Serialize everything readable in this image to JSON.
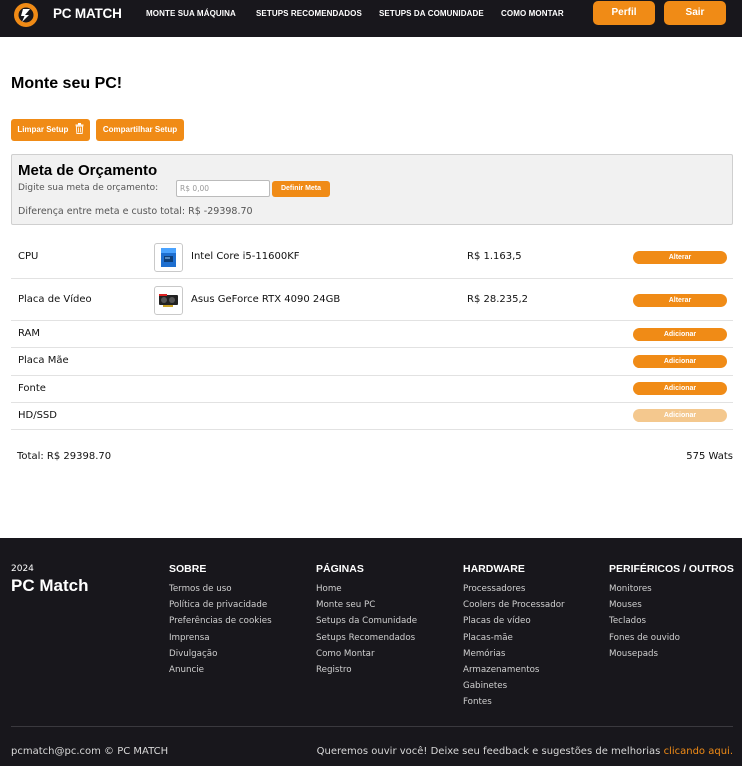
{
  "colors": {
    "accent": "#f08b16",
    "dark": "#18171c"
  },
  "nav": {
    "brand": "PC MATCH",
    "links": [
      "MONTE SUA MÁQUINA",
      "SETUPS RECOMENDADOS",
      "SETUPS DA COMUNIDADE",
      "COMO MONTAR"
    ],
    "profile_button": "Perfil",
    "logout_button": "Sair"
  },
  "main": {
    "title": "Monte seu PC!",
    "clear_button": "Limpar Setup",
    "share_button": "Compartilhar Setup",
    "budget": {
      "title": "Meta de Orçamento",
      "label": "Digite sua meta de orçamento:",
      "placeholder": "R$ 0,00",
      "button": "Definir Meta",
      "difference_text": "Diferença entre meta e custo total: R$ -29398.70"
    },
    "components": [
      {
        "label": "CPU",
        "product": "Intel Core i5-11600KF",
        "price": "R$ 1.163,5",
        "action": "Alterar",
        "icon": "cpu-box-icon"
      },
      {
        "label": "Placa de Vídeo",
        "product": "Asus GeForce RTX 4090 24GB",
        "price": "R$ 28.235,2",
        "action": "Alterar",
        "icon": "gpu-icon"
      },
      {
        "label": "RAM",
        "action": "Adicionar"
      },
      {
        "label": "Placa Mãe",
        "action": "Adicionar"
      },
      {
        "label": "Fonte",
        "action": "Adicionar"
      },
      {
        "label": "HD/SSD",
        "action": "Adicionar"
      }
    ],
    "total": "Total: R$ 29398.70",
    "watts": "575 Wats"
  },
  "footer": {
    "year": "2024",
    "brand": "PC Match",
    "columns": [
      {
        "title": "SOBRE",
        "links": [
          "Termos de uso",
          "Política de privacidade",
          "Preferências de cookies",
          "Imprensa",
          "Divulgação",
          "Anuncie"
        ]
      },
      {
        "title": "PÁGINAS",
        "links": [
          "Home",
          "Monte seu PC",
          "Setups da Comunidade",
          "Setups Recomendados",
          "Como Montar",
          "Registro"
        ]
      },
      {
        "title": "HARDWARE",
        "links": [
          "Processadores",
          "Coolers de Processador",
          "Placas de vídeo",
          "Placas-mãe",
          "Memórias",
          "Armazenamentos",
          "Gabinetes",
          "Fontes"
        ]
      },
      {
        "title": "PERIFÉRICOS / OUTROS",
        "links": [
          "Monitores",
          "Mouses",
          "Teclados",
          "Fones de ouvido",
          "Mousepads"
        ]
      }
    ],
    "copyright": "pcmatch@pc.com © PC MATCH",
    "feedback_text": "Queremos ouvir você! Deixe seu feedback e sugestões de melhorias ",
    "feedback_link": "clicando aqui."
  }
}
